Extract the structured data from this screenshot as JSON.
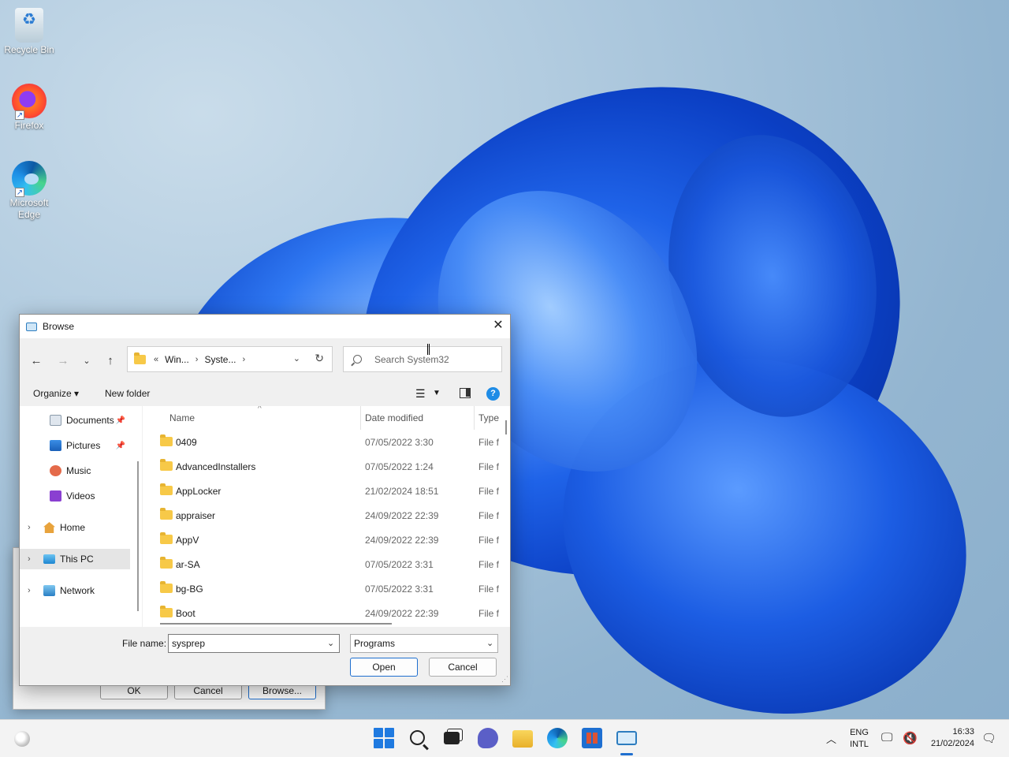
{
  "desktop": {
    "icons": [
      {
        "label": "Recycle Bin"
      },
      {
        "label": "Firefox"
      },
      {
        "label": "Microsoft Edge"
      }
    ]
  },
  "background_window": {
    "ok_label": "OK",
    "cancel_label": "Cancel",
    "browse_label": "Browse..."
  },
  "dialog": {
    "title": "Browse",
    "close_glyph": "✕",
    "breadcrumb": {
      "overflow": "«",
      "items": [
        "Win...",
        "Syste..."
      ]
    },
    "search_placeholder": "Search System32",
    "toolbar": {
      "organize": "Organize ▾",
      "new_folder": "New folder",
      "help": "?"
    },
    "nav_pane": {
      "items": [
        {
          "label": "Documents",
          "icon": "documents-icon",
          "pinned": true
        },
        {
          "label": "Pictures",
          "icon": "pictures-icon",
          "pinned": true
        },
        {
          "label": "Music",
          "icon": "music-icon",
          "pinned": false
        },
        {
          "label": "Videos",
          "icon": "videos-icon",
          "pinned": false
        },
        {
          "label": "Home",
          "icon": "home-icon",
          "expander": true
        },
        {
          "label": "This PC",
          "icon": "this-pc-icon",
          "expander": true,
          "selected": true
        },
        {
          "label": "Network",
          "icon": "network-icon",
          "expander": true
        }
      ]
    },
    "columns": {
      "name": "Name",
      "date": "Date modified",
      "type": "Type"
    },
    "files": [
      {
        "name": "0409",
        "date": "07/05/2022 3:30",
        "type": "File f"
      },
      {
        "name": "AdvancedInstallers",
        "date": "07/05/2022 1:24",
        "type": "File f"
      },
      {
        "name": "AppLocker",
        "date": "21/02/2024 18:51",
        "type": "File f"
      },
      {
        "name": "appraiser",
        "date": "24/09/2022 22:39",
        "type": "File f"
      },
      {
        "name": "AppV",
        "date": "24/09/2022 22:39",
        "type": "File f"
      },
      {
        "name": "ar-SA",
        "date": "07/05/2022 3:31",
        "type": "File f"
      },
      {
        "name": "bg-BG",
        "date": "07/05/2022 3:31",
        "type": "File f"
      },
      {
        "name": "Boot",
        "date": "24/09/2022 22:39",
        "type": "File f"
      }
    ],
    "file_name_label": "File name:",
    "file_name_value": "sysprep",
    "file_type_value": "Programs",
    "open_label": "Open",
    "cancel_label": "Cancel"
  },
  "taskbar": {
    "language": "ENG",
    "layout": "INTL",
    "time": "16:33",
    "date": "21/02/2024"
  },
  "colors": {
    "accent": "#1f6fcf",
    "folder": "#f7c948"
  }
}
